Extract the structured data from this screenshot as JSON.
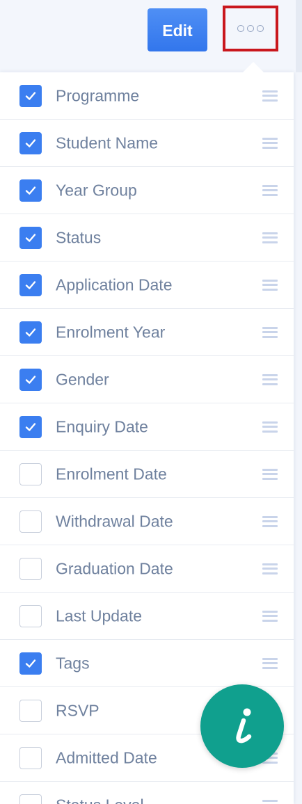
{
  "toolbar": {
    "edit_label": "Edit",
    "more_icon": "ellipsis-icon"
  },
  "columns": [
    {
      "label": "Programme",
      "checked": true
    },
    {
      "label": "Student Name",
      "checked": true
    },
    {
      "label": "Year Group",
      "checked": true
    },
    {
      "label": "Status",
      "checked": true
    },
    {
      "label": "Application Date",
      "checked": true
    },
    {
      "label": "Enrolment Year",
      "checked": true
    },
    {
      "label": "Gender",
      "checked": true
    },
    {
      "label": "Enquiry Date",
      "checked": true
    },
    {
      "label": "Enrolment Date",
      "checked": false
    },
    {
      "label": "Withdrawal Date",
      "checked": false
    },
    {
      "label": "Graduation Date",
      "checked": false
    },
    {
      "label": "Last Update",
      "checked": false
    },
    {
      "label": "Tags",
      "checked": true
    },
    {
      "label": "RSVP",
      "checked": false
    },
    {
      "label": "Admitted Date",
      "checked": false
    },
    {
      "label": "Status Level",
      "checked": false
    }
  ],
  "info_fab": {
    "icon": "info-icon"
  },
  "colors": {
    "accent_blue": "#3b7ef0",
    "highlight_red": "#c9171d",
    "fab_teal": "#10a08e",
    "label_text": "#6f819e"
  }
}
